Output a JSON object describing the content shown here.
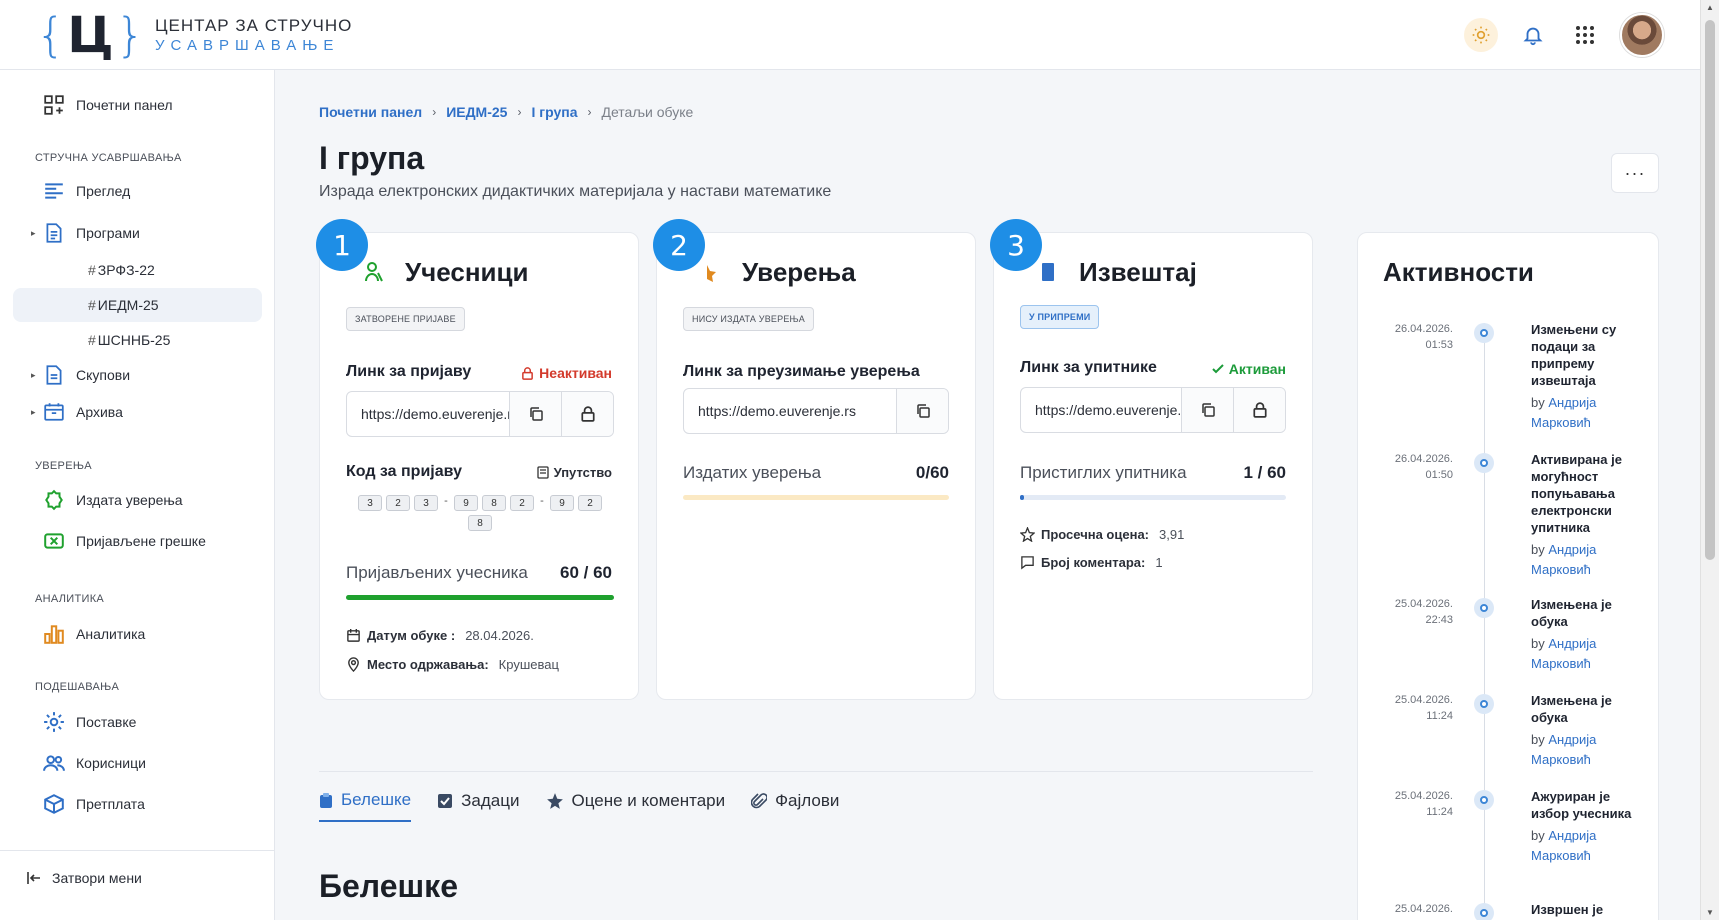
{
  "header": {
    "logo_letter": "Ц",
    "logo_line1": "ЦЕНТАР ЗА СТРУЧНО",
    "logo_line2": "УСАВРШАВАЊЕ"
  },
  "sidebar": {
    "dashboard": "Почетни панел",
    "section_training": "СТРУЧНА УСАВРШАВАЊА",
    "overview": "Преглед",
    "programs": "Програми",
    "program_items": [
      "ЗРФЗ-22",
      "ИЕДМ-25",
      "ШСННБ-25"
    ],
    "meetings": "Скупови",
    "archive": "Архива",
    "section_certificates": "УВЕРЕЊА",
    "issued_certificates": "Издата уверења",
    "reported_errors": "Пријављене грешке",
    "section_analytics": "АНАЛИТИКА",
    "analytics": "Аналитика",
    "section_settings": "ПОДЕШАВАЊА",
    "settings": "Поставке",
    "users": "Корисници",
    "subscription": "Претплата",
    "close_menu": "Затвори мени"
  },
  "breadcrumb": [
    "Почетни панел",
    "ИЕДМ-25",
    "I група",
    "Детаљи обуке"
  ],
  "page": {
    "title": "I група",
    "subtitle": "Израда електронских дидактичких материјала у настави математике",
    "more": "···"
  },
  "cards": {
    "participants": {
      "num": "1",
      "title": "Учесници",
      "badge": "ЗАТВОРЕНЕ ПРИЈАВЕ",
      "link_label": "Линк за пријаву",
      "link_status": "Неактиван",
      "link_value": "https://demo.euverenje.rs",
      "code_label": "Код за пријаву",
      "guide": "Упутство",
      "code_digits": [
        "3",
        "2",
        "3",
        "-",
        "9",
        "8",
        "2",
        "-",
        "9",
        "2",
        "8"
      ],
      "progress_label": "Пријављених учесника",
      "progress_value": "60 / 60",
      "progress_fraction": 1.0,
      "date_label": "Датум обуке :",
      "date_value": "28.04.2026.",
      "place_label": "Место одржавања:",
      "place_value": "Крушевац"
    },
    "certificates": {
      "num": "2",
      "title": "Уверења",
      "badge": "НИСУ ИЗДАТА УВЕРЕЊА",
      "link_label": "Линк за преузимање уверења",
      "link_value": "https://demo.euverenje.rs",
      "progress_label": "Издатих уверења",
      "progress_value": "0/60",
      "progress_fraction": 0.0
    },
    "report": {
      "num": "3",
      "title": "Извештај",
      "badge": "У ПРИПРЕМИ",
      "link_label": "Линк за упитнике",
      "link_status": "Активан",
      "link_value": "https://demo.euverenje.rs",
      "progress_label": "Пристиглих упитника",
      "progress_value": "1 / 60",
      "progress_fraction": 0.0167,
      "avg_label": "Просечна оцена:",
      "avg_value": "3,91",
      "comments_label": "Број коментара:",
      "comments_value": "1"
    }
  },
  "tabs": [
    "Белешке",
    "Задаци",
    "Оцене и коментари",
    "Фајлови"
  ],
  "section_title": "Белешке",
  "activities": {
    "title": "Активности",
    "items": [
      {
        "date": "26.04.2026.",
        "time": "01:53",
        "text": "Измењени су подаци за припрему извештаја",
        "by": "by",
        "user": "Андрија Марковић"
      },
      {
        "date": "26.04.2026.",
        "time": "01:50",
        "text": "Активирана је могућност попуњавања електронски упитника",
        "by": "by",
        "user": "Андрија Марковић"
      },
      {
        "date": "25.04.2026.",
        "time": "22:43",
        "text": "Измењена је обука",
        "by": "by",
        "user": "Андрија Марковић"
      },
      {
        "date": "25.04.2026.",
        "time": "11:24",
        "text": "Измењена је обука",
        "by": "by",
        "user": "Андрија Марковић"
      },
      {
        "date": "25.04.2026.",
        "time": "11:24",
        "text": "Ажуриран је избор учесника",
        "by": "by",
        "user": "Андрија Марковић"
      },
      {
        "date": "25.04.2026.",
        "time": "",
        "text": "Извршен је",
        "by": "",
        "user": ""
      }
    ]
  },
  "colors": {
    "accent": "#2f6fc6",
    "badge_blue": "#1e8ee6",
    "progress_green": "#1fa12e",
    "progress_empty_yellow": "#fbe9c4",
    "progress_track_blue": "#e3eaf5",
    "status_red": "#d33a2c",
    "status_green": "#1c9b3a"
  }
}
